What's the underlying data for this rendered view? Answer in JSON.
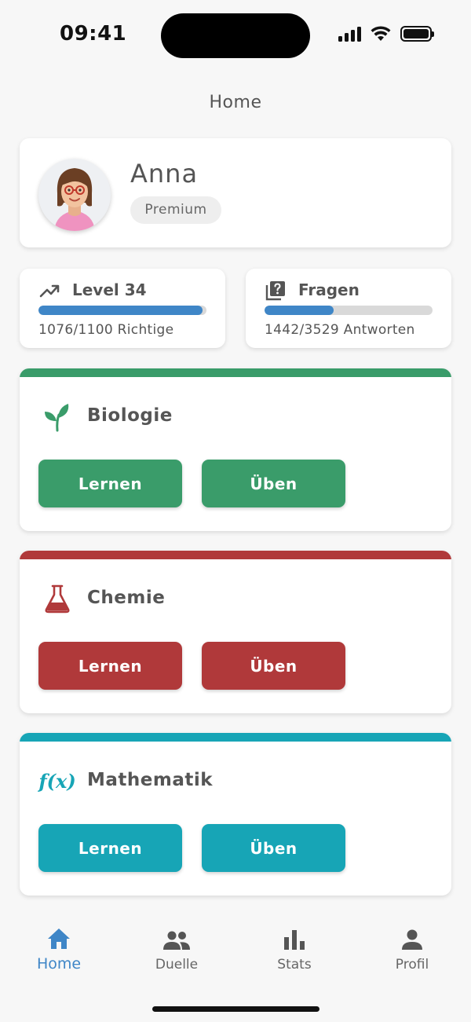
{
  "status_bar": {
    "time": "09:41"
  },
  "header": {
    "title": "Home"
  },
  "profile": {
    "name": "Anna",
    "badge": "Premium"
  },
  "stats": {
    "level": {
      "title": "Level 34",
      "caption": "1076/1100 Richtige",
      "progress": 0.978,
      "icon": "trending-up-icon"
    },
    "questions": {
      "title": "Fragen",
      "caption": "1442/3529 Antworten",
      "progress": 0.409,
      "icon": "question-box-icon"
    }
  },
  "subjects": [
    {
      "name": "Biologie",
      "icon": "sprout-icon",
      "color": "#3a9c6a",
      "learn_label": "Lernen",
      "practice_label": "Üben"
    },
    {
      "name": "Chemie",
      "icon": "flask-icon",
      "color": "#b0393a",
      "learn_label": "Lernen",
      "practice_label": "Üben"
    },
    {
      "name": "Mathematik",
      "icon": "function-icon",
      "icon_text": "f(x)",
      "color": "#17a5b6",
      "learn_label": "Lernen",
      "practice_label": "Üben"
    }
  ],
  "tabbar": {
    "items": [
      {
        "label": "Home",
        "icon": "home-icon",
        "active": true
      },
      {
        "label": "Duelle",
        "icon": "people-icon",
        "active": false
      },
      {
        "label": "Stats",
        "icon": "bar-chart-icon",
        "active": false
      },
      {
        "label": "Profil",
        "icon": "person-icon",
        "active": false
      }
    ]
  },
  "colors": {
    "accent": "#3f86c7",
    "progress_track": "#d9d9d9"
  }
}
